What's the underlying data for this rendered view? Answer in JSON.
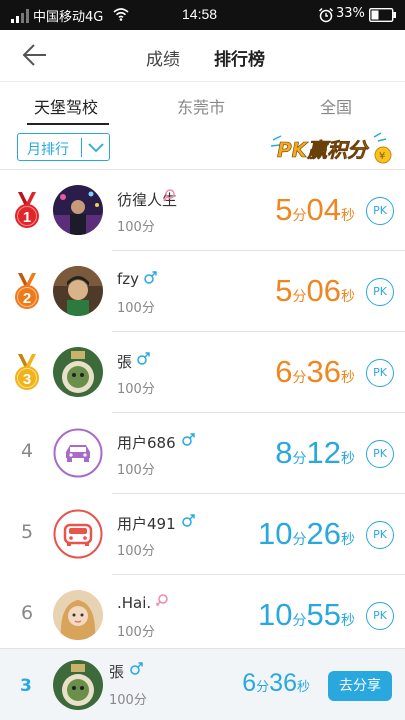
{
  "status_bar": {
    "carrier": "中国移动4G",
    "time": "14:58",
    "battery": "33%"
  },
  "header": {
    "tabs": [
      {
        "label": "成绩"
      },
      {
        "label": "排行榜"
      }
    ],
    "active_tab": "排行榜"
  },
  "subtabs": [
    {
      "label": "天堡驾校"
    },
    {
      "label": "东莞市"
    },
    {
      "label": "全国"
    }
  ],
  "active_subtab": "天堡驾校",
  "filter": {
    "period_label": "月排行",
    "pk_banner": "PK赢积分"
  },
  "ranking": [
    {
      "rank": "1",
      "name": "彷徨人生",
      "gender": "female",
      "score": "100分",
      "time": {
        "min": "5",
        "min_unit": "分",
        "sec": "04",
        "sec_unit": "秒"
      },
      "pk_label": "PK"
    },
    {
      "rank": "2",
      "name": "fzy",
      "gender": "male",
      "score": "100分",
      "time": {
        "min": "5",
        "min_unit": "分",
        "sec": "06",
        "sec_unit": "秒"
      },
      "pk_label": "PK"
    },
    {
      "rank": "3",
      "name": "張",
      "gender": "male",
      "score": "100分",
      "time": {
        "min": "6",
        "min_unit": "分",
        "sec": "36",
        "sec_unit": "秒"
      },
      "pk_label": "PK"
    },
    {
      "rank": "4",
      "name": "用户686",
      "gender": "male",
      "score": "100分",
      "time": {
        "min": "8",
        "min_unit": "分",
        "sec": "12",
        "sec_unit": "秒"
      },
      "pk_label": "PK"
    },
    {
      "rank": "5",
      "name": "用户491",
      "gender": "male",
      "score": "100分",
      "time": {
        "min": "10",
        "min_unit": "分",
        "sec": "26",
        "sec_unit": "秒"
      },
      "pk_label": "PK"
    },
    {
      "rank": "6",
      "name": ".Hai.",
      "gender": "female",
      "score": "100分",
      "time": {
        "min": "10",
        "min_unit": "分",
        "sec": "55",
        "sec_unit": "秒"
      },
      "pk_label": "PK"
    }
  ],
  "my_rank": {
    "rank": "3",
    "name": "張",
    "gender": "male",
    "score": "100分",
    "time": {
      "min": "6",
      "min_unit": "分",
      "sec": "36",
      "sec_unit": "秒"
    },
    "share_label": "去分享"
  },
  "colors": {
    "accent": "#29a8e0",
    "orange": "#f0861f",
    "medal_red": "#e0262b",
    "medal_orange": "#ef7a1c",
    "medal_gold": "#f1b21a"
  }
}
